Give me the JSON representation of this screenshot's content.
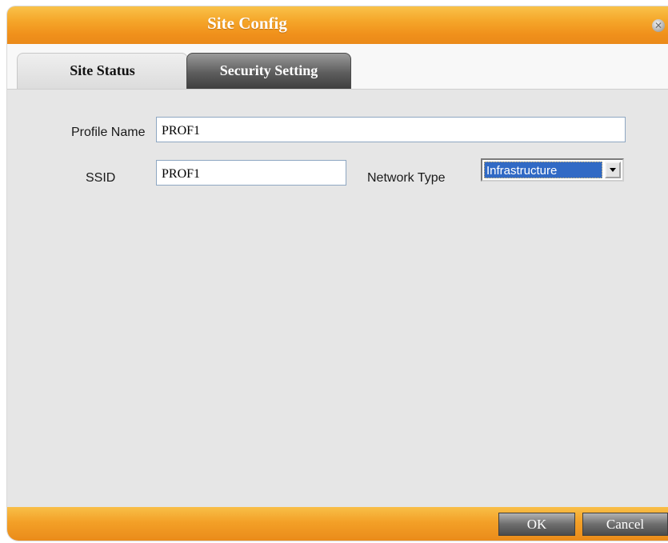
{
  "window": {
    "title": "Site Config",
    "close_icon": "close-icon"
  },
  "tabs": [
    {
      "label": "Site Status",
      "active": true
    },
    {
      "label": "Security Setting",
      "active": false
    }
  ],
  "form": {
    "profile_name_label": "Profile Name",
    "profile_name_value": "PROF1",
    "ssid_label": "SSID",
    "ssid_value": "PROF1",
    "network_type_label": "Network Type",
    "network_type_value": "Infrastructure"
  },
  "footer": {
    "ok_label": "OK",
    "cancel_label": "Cancel"
  },
  "colors": {
    "accent_orange": "#f0901b",
    "selection_blue": "#316ac5"
  }
}
